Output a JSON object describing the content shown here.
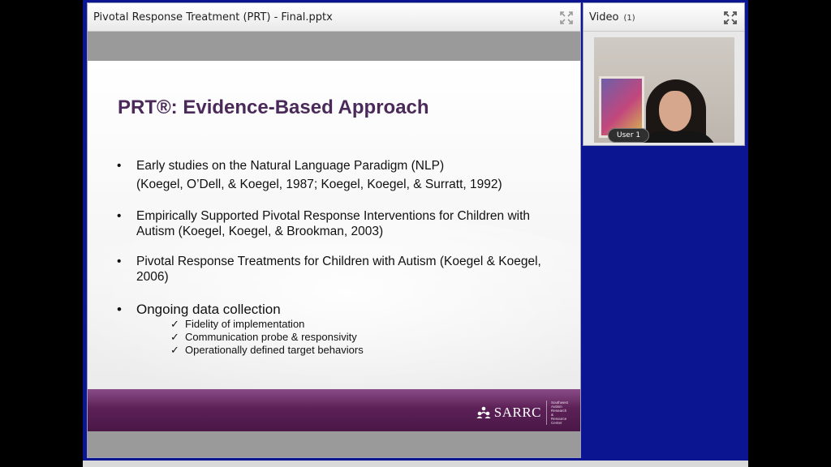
{
  "presentation_pod": {
    "title": "Pivotal Response Treatment (PRT) - Final.pptx"
  },
  "slide": {
    "title": "PRT®: Evidence-Based Approach",
    "bullet_char": "•",
    "bullets": [
      {
        "text": "Early studies on the Natural Language Paradigm (NLP)",
        "citation": "(Koegel, O’Dell, & Koegel, 1987; Koegel, Koegel, & Surratt, 1992)"
      },
      {
        "text": "Empirically Supported Pivotal Response Interventions for Children with Autism (Koegel, Koegel, & Brookman, 2003)"
      },
      {
        "text": "Pivotal Response Treatments for Children with Autism (Koegel & Koegel, 2006)"
      },
      {
        "text": "Ongoing data collection"
      }
    ],
    "check_char": "✓",
    "sub_items": [
      "Fidelity of implementation",
      "Communication probe & responsivity",
      "Operationally defined target behaviors"
    ],
    "logo_text": "SARRC",
    "logo_tagline": "Southwest Autism Research & Resource Center",
    "footer_color": "#5c2157"
  },
  "video_pod": {
    "title": "Video",
    "count": "(1)",
    "user_label": "User 1"
  },
  "colors": {
    "stage_bg": "#0b1592",
    "title_color": "#4b2a5a"
  },
  "icons": {
    "fullscreen": "fullscreen-icon"
  }
}
